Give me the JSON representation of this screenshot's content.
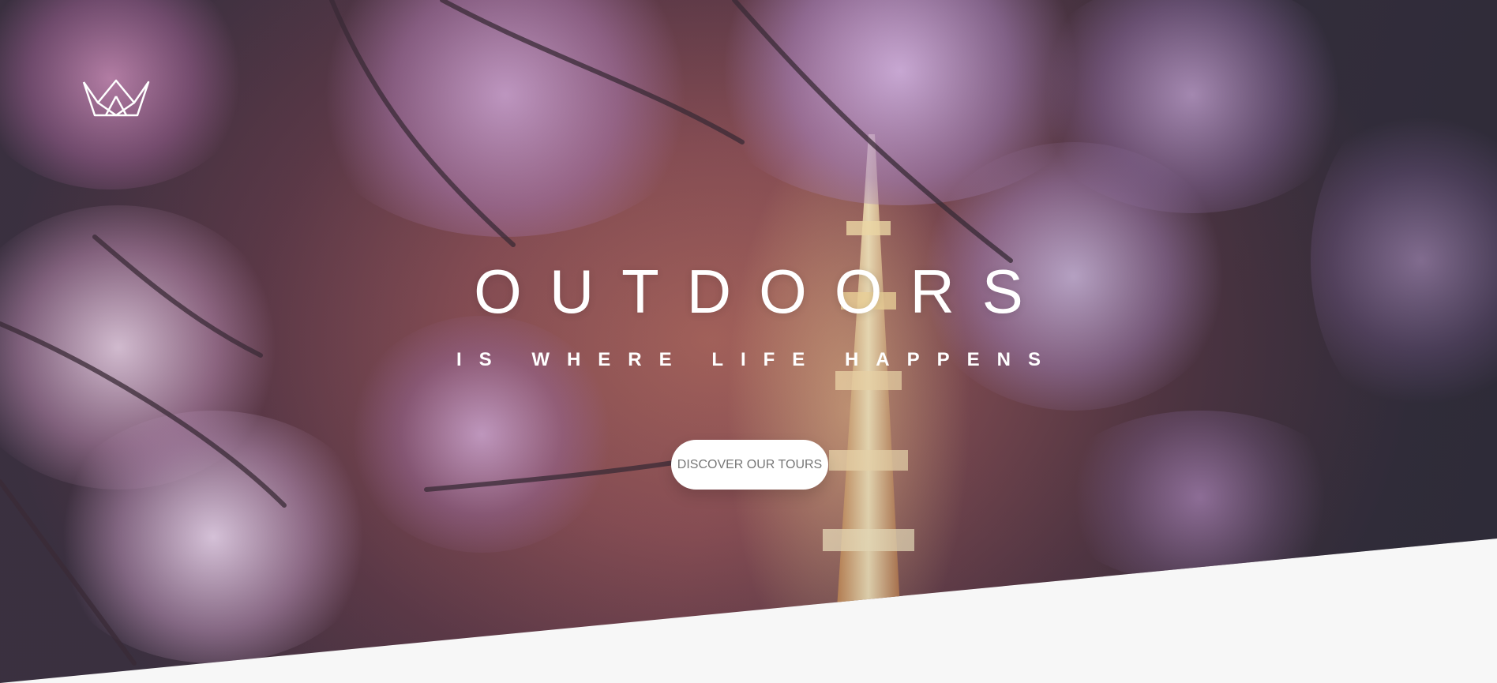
{
  "header": {
    "logo_icon": "crown-logo-icon"
  },
  "hero": {
    "title_main": "OUTDOORS",
    "title_sub": "IS WHERE LIFE HAPPENS",
    "cta_label": "DISCOVER OUR TOURS",
    "background": "cherry-blossoms-and-lit-tower-photo"
  },
  "colors": {
    "text_primary": "#ffffff",
    "button_bg": "#ffffff",
    "button_text": "#777777",
    "section_bg": "#f7f7f7"
  }
}
